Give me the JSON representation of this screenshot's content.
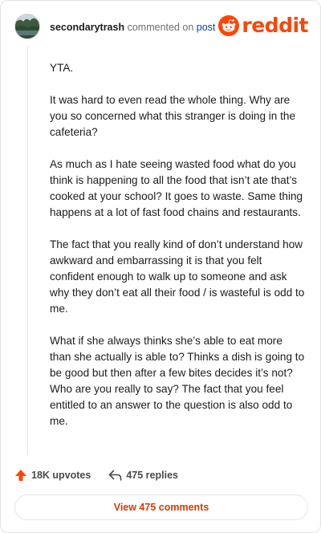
{
  "comment": {
    "username": "secondarytrash",
    "commented_on": "commented on",
    "post_link": "post",
    "paragraphs": [
      "YTA.",
      "It was hard to even read the whole thing. Why are you so concerned what this stranger is doing in the cafeteria?",
      "As much as I hate seeing wasted food what do you think is happening to all the food that isn’t ate that’s cooked at your school? It goes to waste. Same thing happens at a lot of fast food chains and restaurants.",
      "The fact that you really kind of don’t understand how awkward and embarrassing it is that you felt confident enough to walk up to someone and ask why they don’t eat all their food / is wasteful is odd to me.",
      "What if she always thinks she’s able to eat more than she actually is able to? Thinks a dish is going to be good but then after a few bites decides it’s not? Who are you really to say? The fact that you feel entitled to an answer to the question is also odd to me."
    ],
    "upvotes": "18K upvotes",
    "replies": "475 replies",
    "view_button": "View 475 comments"
  },
  "brand": {
    "wordmark": "reddit",
    "color": "#ff4500"
  },
  "icons": {
    "avatar": "avatar-image",
    "logo": "reddit-snoo-icon",
    "upvote": "upvote-arrow-icon",
    "reply": "reply-arrow-icon"
  },
  "colors": {
    "accent": "#ff4500",
    "link": "#0045ac",
    "button_text": "#d93a00"
  }
}
